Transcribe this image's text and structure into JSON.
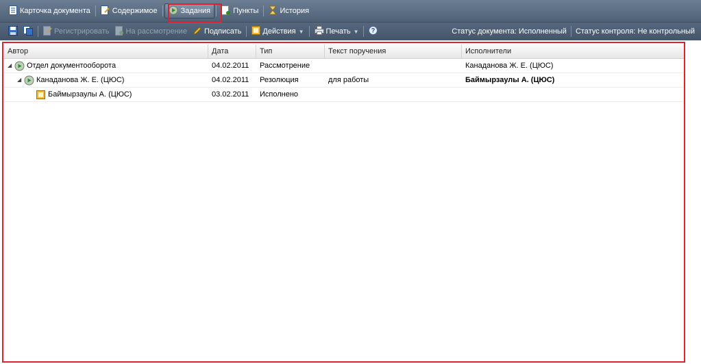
{
  "tabs": [
    {
      "label": "Карточка документа",
      "icon": "document-card-icon"
    },
    {
      "label": "Содержимое",
      "icon": "content-icon"
    },
    {
      "label": "Задания",
      "icon": "tasks-icon",
      "active": true
    },
    {
      "label": "Пункты",
      "icon": "items-icon"
    },
    {
      "label": "История",
      "icon": "history-icon"
    }
  ],
  "toolbar": {
    "register_label": "Регистрировать",
    "review_label": "На рассмотрение",
    "sign_label": "Подписать",
    "actions_label": "Действия",
    "print_label": "Печать",
    "doc_status_label": "Статус документа:",
    "doc_status_value": "Исполненный",
    "control_status_label": "Статус контроля:",
    "control_status_value": "Не контрольный"
  },
  "grid": {
    "columns": [
      "Автор",
      "Дата",
      "Тип",
      "Текст поручения",
      "Исполнители"
    ],
    "rows": [
      {
        "author": "Отдел документооборота",
        "date": "04.02.2011",
        "type": "Рассмотрение",
        "text": "",
        "executors": "Канаданова Ж. Е. (ЦЮС)"
      },
      {
        "author": "Канаданова Ж. Е. (ЦЮС)",
        "date": "04.02.2011",
        "type": "Резолюция",
        "text": "для работы",
        "executors": "Баймырзаулы А. (ЦЮС)"
      },
      {
        "author": "Баймырзаулы А. (ЦЮС)",
        "date": "03.02.2011",
        "type": "Исполнено",
        "text": "",
        "executors": ""
      }
    ]
  },
  "colors": {
    "highlight": "#e0202e",
    "tabbar": "#5d6f85"
  }
}
